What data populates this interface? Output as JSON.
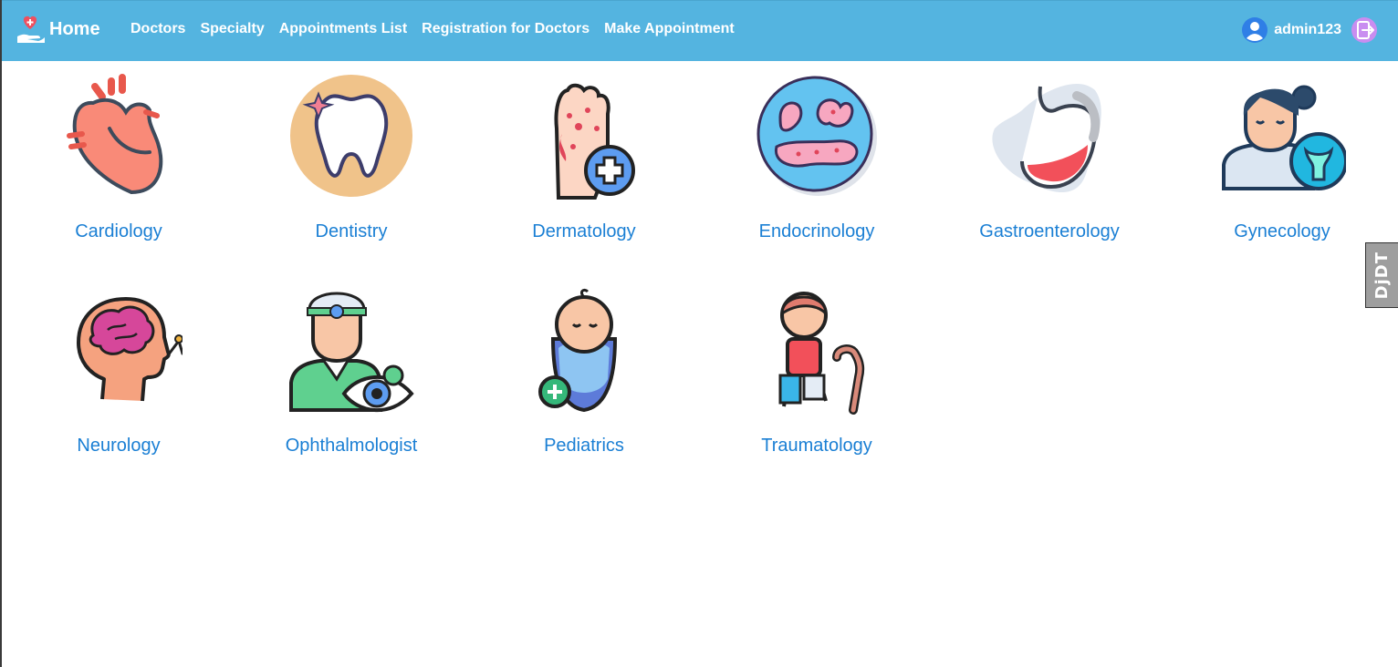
{
  "navbar": {
    "brand_label": "Home",
    "links": [
      "Doctors",
      "Specialty",
      "Appointments List",
      "Registration for Doctors",
      "Make Appointment"
    ],
    "username": "admin123",
    "background_color": "#54b4e0"
  },
  "specialties": [
    {
      "label": "Cardiology",
      "icon": "heart-icon"
    },
    {
      "label": "Dentistry",
      "icon": "tooth-icon"
    },
    {
      "label": "Dermatology",
      "icon": "skin-hand-icon"
    },
    {
      "label": "Endocrinology",
      "icon": "thyroid-icon"
    },
    {
      "label": "Gastroenterology",
      "icon": "stomach-icon"
    },
    {
      "label": "Gynecology",
      "icon": "gynecologist-icon"
    },
    {
      "label": "Neurology",
      "icon": "brain-head-icon"
    },
    {
      "label": "Ophthalmologist",
      "icon": "eye-doctor-icon"
    },
    {
      "label": "Pediatrics",
      "icon": "baby-icon"
    },
    {
      "label": "Traumatology",
      "icon": "injured-person-icon"
    }
  ],
  "label_color": "#1a7fd4",
  "debug_toolbar": {
    "label": "DjDT"
  }
}
